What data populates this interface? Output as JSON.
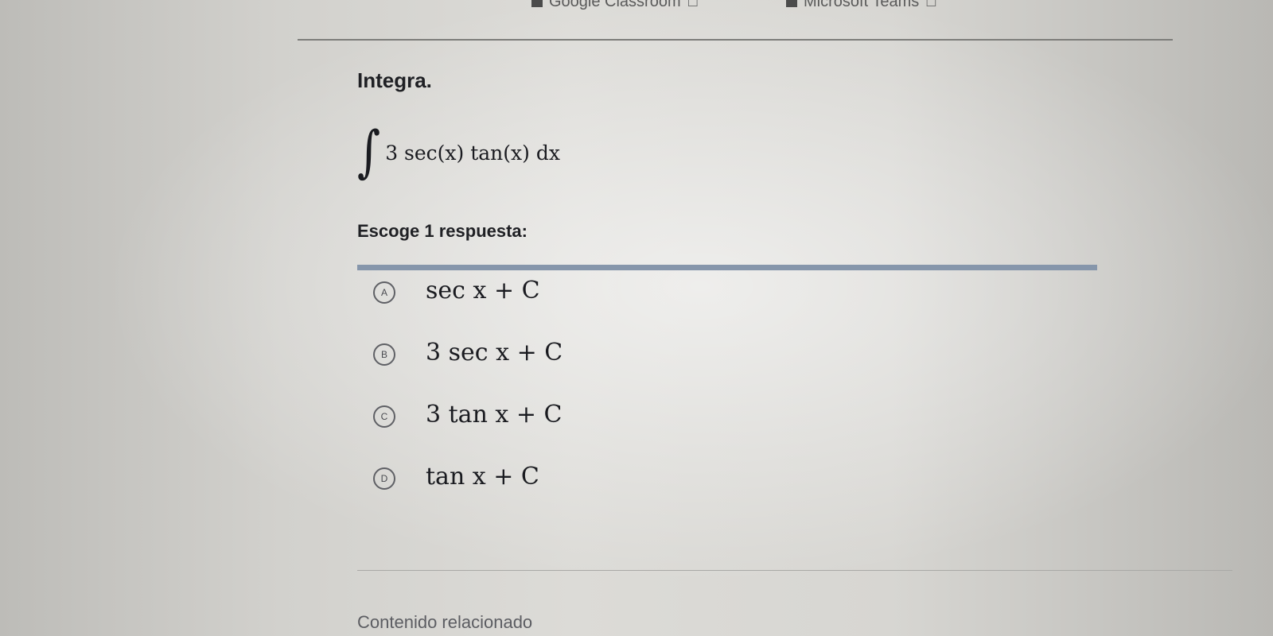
{
  "top_links": {
    "classroom": "Google Classroom",
    "teams": "Microsoft Teams"
  },
  "question": {
    "title": "Integra.",
    "integral_sign": "∫",
    "integrand": "3 sec(x) tan(x) dx"
  },
  "prompt": "Escoge 1 respuesta:",
  "choices": [
    {
      "letter": "A",
      "expr": "sec x + C"
    },
    {
      "letter": "B",
      "expr": "3 sec x + C"
    },
    {
      "letter": "C",
      "expr": "3 tan x + C"
    },
    {
      "letter": "D",
      "expr": "tan x + C"
    }
  ],
  "related_content": "Contenido relacionado",
  "colors": {
    "choices_rule": "#8696ab",
    "text": "#21242c"
  }
}
